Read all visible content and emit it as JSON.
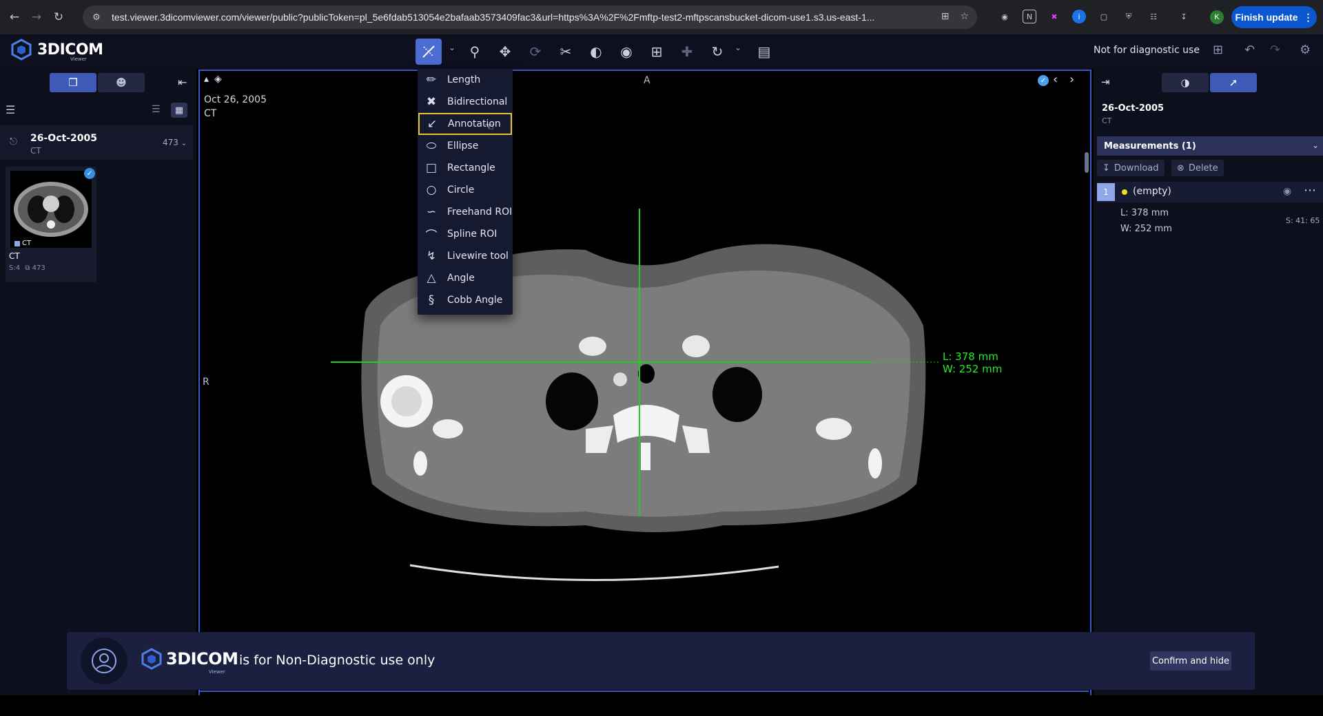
{
  "browser": {
    "url": "test.viewer.3dicomviewer.com/viewer/public?publicToken=pl_5e6fdab513054e2bafaab3573409fac3&url=https%3A%2F%2Fmftp-test2-mftpscansbucket-dicom-use1.s3.us-east-1...",
    "finish_update": "Finish update",
    "profile_initial": "K"
  },
  "app": {
    "logo_text": "3DICOM",
    "logo_sub": "Viewer",
    "not_diagnostic": "Not for diagnostic use"
  },
  "left": {
    "study_date": "26-Oct-2005",
    "study_modality": "CT",
    "study_count": "473",
    "series": {
      "badge": "CT",
      "name": "CT",
      "slices": "S:4",
      "images": "473"
    }
  },
  "viewport": {
    "date": "Oct 26, 2005",
    "modality": "CT",
    "orientation_top": "A",
    "orientation_left": "R",
    "measure_length": "L: 378 mm",
    "measure_width": "W: 252 mm"
  },
  "tool_menu": {
    "items": [
      {
        "label": "Length",
        "icon": "ruler-icon"
      },
      {
        "label": "Bidirectional",
        "icon": "bidirectional-icon"
      },
      {
        "label": "Annotation",
        "icon": "arrow-annotation-icon"
      },
      {
        "label": "Ellipse",
        "icon": "ellipse-icon"
      },
      {
        "label": "Rectangle",
        "icon": "rectangle-icon"
      },
      {
        "label": "Circle",
        "icon": "circle-icon"
      },
      {
        "label": "Freehand ROI",
        "icon": "freehand-icon"
      },
      {
        "label": "Spline ROI",
        "icon": "spline-icon"
      },
      {
        "label": "Livewire tool",
        "icon": "livewire-icon"
      },
      {
        "label": "Angle",
        "icon": "angle-icon"
      },
      {
        "label": "Cobb Angle",
        "icon": "cobb-angle-icon"
      }
    ],
    "highlighted": "Annotation"
  },
  "right": {
    "date": "26-Oct-2005",
    "modality": "CT",
    "measurements_title": "Measurements (1)",
    "download": "Download",
    "delete": "Delete",
    "measurement": {
      "index": "1",
      "label": "(empty)",
      "length": "L: 378 mm",
      "width": "W: 252 mm",
      "slice": "S: 41: 65"
    }
  },
  "banner": {
    "logo_text": "3DICOM",
    "logo_sub": "Viewer",
    "message": "is for Non-Diagnostic use only",
    "confirm": "Confirm and hide"
  },
  "colors": {
    "accent": "#3f5bb7",
    "highlight": "#e5c52e",
    "measurement": "#22ee22",
    "finish_update": "#0b57d0"
  }
}
